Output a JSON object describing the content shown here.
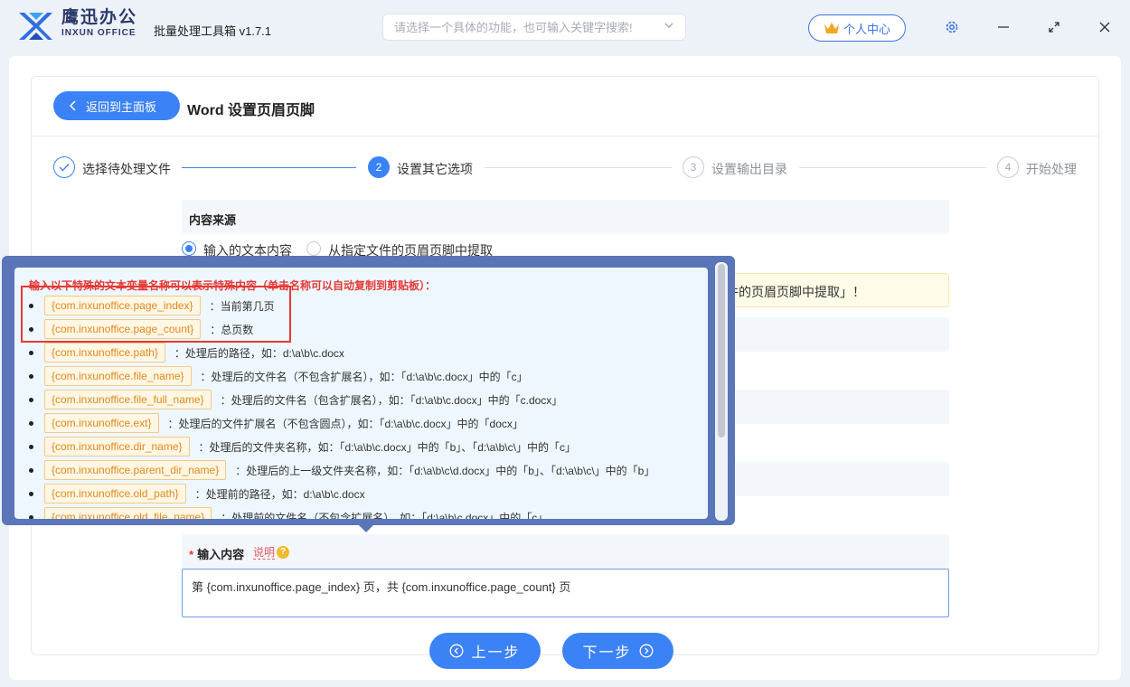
{
  "app": {
    "brand_cn": "鹰迅办公",
    "brand_en": "INXUN OFFICE",
    "title": "批量处理工具箱 v1.7.1"
  },
  "search": {
    "placeholder": "请选择一个具体的功能，也可输入关键字搜索!"
  },
  "header": {
    "user_center": "个人中心"
  },
  "page": {
    "back_label": "返回到主面板",
    "heading": "Word 设置页眉页脚"
  },
  "steps": [
    {
      "num": "1",
      "label": "选择待处理文件",
      "state": "done"
    },
    {
      "num": "2",
      "label": "设置其它选项",
      "state": "active"
    },
    {
      "num": "3",
      "label": "设置输出目录",
      "state": "pending"
    },
    {
      "num": "4",
      "label": "开始处理",
      "state": "pending"
    }
  ],
  "content_source": {
    "title": "内容来源",
    "options": [
      {
        "label": "输入的文本内容",
        "selected": true
      },
      {
        "label": "从指定文件的页眉页脚中提取",
        "selected": false
      }
    ],
    "notice_visible": "件的页眉页脚中提取」！"
  },
  "input_content": {
    "label": "输入内容",
    "help": "说明",
    "help_icon": "?",
    "value": "第 {com.inxunoffice.page_index} 页，共 {com.inxunoffice.page_count} 页"
  },
  "nav": {
    "prev": "上一步",
    "next": "下一步"
  },
  "popup": {
    "title": "输入以下特殊的文本变量名称可以表示特殊内容（单击名称可以自动复制到剪贴板）：",
    "variables": [
      {
        "name": "{com.inxunoffice.page_index}",
        "desc": "：当前第几页"
      },
      {
        "name": "{com.inxunoffice.page_count}",
        "desc": "：总页数"
      },
      {
        "name": "{com.inxunoffice.path}",
        "desc": "：处理后的路径，如：d:\\a\\b\\c.docx"
      },
      {
        "name": "{com.inxunoffice.file_name}",
        "desc": "：处理后的文件名（不包含扩展名），如：「d:\\a\\b\\c.docx」中的「c」"
      },
      {
        "name": "{com.inxunoffice.file_full_name}",
        "desc": "：处理后的文件名（包含扩展名），如：「d:\\a\\b\\c.docx」中的「c.docx」"
      },
      {
        "name": "{com.inxunoffice.ext}",
        "desc": "：处理后的文件扩展名（不包含圆点），如：「d:\\a\\b\\c.docx」中的「docx」"
      },
      {
        "name": "{com.inxunoffice.dir_name}",
        "desc": "：处理后的文件夹名称，如：「d:\\a\\b\\c.docx」中的「b」、「d:\\a\\b\\c\\」中的「c」"
      },
      {
        "name": "{com.inxunoffice.parent_dir_name}",
        "desc": "：处理后的上一级文件夹名称，如：「d:\\a\\b\\c\\d.docx」中的「b」、「d:\\a\\b\\c\\」中的「b」"
      },
      {
        "name": "{com.inxunoffice.old_path}",
        "desc": "：处理前的路径，如：d:\\a\\b\\c.docx"
      },
      {
        "name": "{com.inxunoffice.old_file_name}",
        "desc": "：处理前的文件名（不包含扩展名），如：「d:\\a\\b\\c.docx」中的「c」"
      }
    ]
  },
  "colors": {
    "accent": "#3b82f6",
    "popup_frame": "#5a76b8",
    "highlight": "#e53935",
    "tag_text": "#e08a1e"
  }
}
